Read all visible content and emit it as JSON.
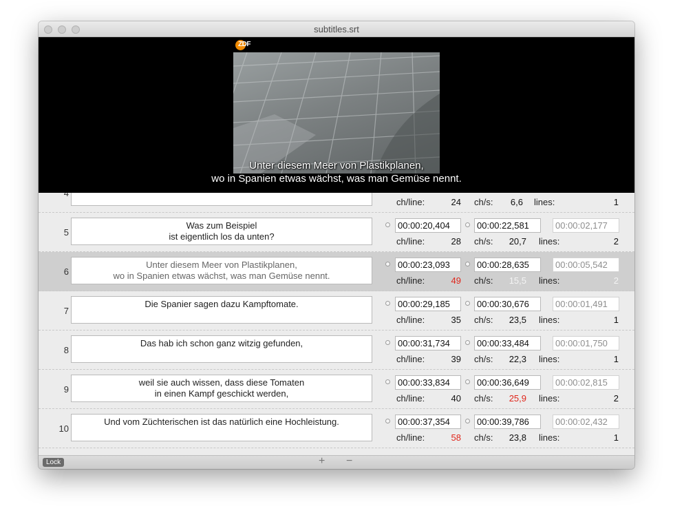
{
  "window": {
    "title": "subtitles.srt"
  },
  "video": {
    "channel_logo": "ZDF",
    "subtitle_lines": [
      "Unter diesem Meer von Plastikplanen,",
      "wo in Spanien etwas wächst, was man Gemüse nennt."
    ]
  },
  "labels": {
    "ch_line": "ch/line:",
    "ch_s": "ch/s:",
    "lines": "lines:"
  },
  "partial_row": {
    "number": "4",
    "ch_line": "24",
    "ch_s": "6,6",
    "lines": "1"
  },
  "rows": [
    {
      "number": "5",
      "text": [
        "Was zum Beispiel",
        "ist eigentlich los da unten?"
      ],
      "start": "00:00:20,404",
      "end": "00:00:22,581",
      "duration": "00:00:02,177",
      "ch_line": "28",
      "ch_s": "20,7",
      "lines": "2",
      "ch_line_warn": false,
      "ch_s_warn": false
    },
    {
      "number": "6",
      "text": [
        "Unter diesem Meer von Plastikplanen,",
        "wo in Spanien etwas wächst, was man Gemüse nennt."
      ],
      "start": "00:00:23,093",
      "end": "00:00:28,635",
      "duration": "00:00:05,542",
      "ch_line": "49",
      "ch_s": "15,5",
      "lines": "2",
      "ch_line_warn": true,
      "ch_s_warn": false,
      "selected": true
    },
    {
      "number": "7",
      "text": [
        "Die Spanier sagen dazu Kampftomate."
      ],
      "start": "00:00:29,185",
      "end": "00:00:30,676",
      "duration": "00:00:01,491",
      "ch_line": "35",
      "ch_s": "23,5",
      "lines": "1",
      "ch_line_warn": false,
      "ch_s_warn": false
    },
    {
      "number": "8",
      "text": [
        "Das hab ich schon ganz witzig gefunden,"
      ],
      "start": "00:00:31,734",
      "end": "00:00:33,484",
      "duration": "00:00:01,750",
      "ch_line": "39",
      "ch_s": "22,3",
      "lines": "1",
      "ch_line_warn": false,
      "ch_s_warn": false
    },
    {
      "number": "9",
      "text": [
        "weil sie auch wissen, dass diese Tomaten",
        "in einen Kampf geschickt werden,"
      ],
      "start": "00:00:33,834",
      "end": "00:00:36,649",
      "duration": "00:00:02,815",
      "ch_line": "40",
      "ch_s": "25,9",
      "lines": "2",
      "ch_line_warn": false,
      "ch_s_warn": true
    },
    {
      "number": "10",
      "text": [
        "Und vom Züchterischen ist das natürlich eine Hochleistung."
      ],
      "start": "00:00:37,354",
      "end": "00:00:39,786",
      "duration": "00:00:02,432",
      "ch_line": "58",
      "ch_s": "23,8",
      "lines": "1",
      "ch_line_warn": true,
      "ch_s_warn": false
    }
  ],
  "bottom_bar": {
    "lock_label": "Lock",
    "add_label": "+",
    "remove_label": "−"
  },
  "colors": {
    "warning": "#e0261b",
    "selected_row": "#cfcfcf",
    "logo": "#f08a00"
  }
}
